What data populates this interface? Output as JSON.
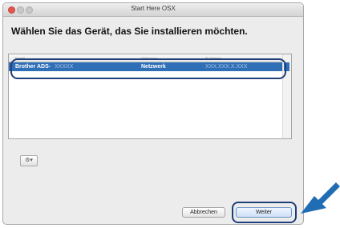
{
  "window": {
    "title": "Start Here OSX"
  },
  "heading": "Wählen Sie das Gerät, das Sie installieren möchten.",
  "list": {
    "columns": [
      "Modell",
      "Verbindung",
      "IP-Adresse"
    ],
    "rows": [
      {
        "model": "Brother ADS-",
        "model_masked": "XXXXX",
        "connection": "Netzwerk",
        "address": "XXX.XXX.X.XXX"
      }
    ]
  },
  "icons": {
    "gear": "gear-icon",
    "arrow": "pointer-arrow-icon"
  },
  "buttons": {
    "cancel": "Abbrechen",
    "next": "Weiter"
  },
  "colors": {
    "selection": "#2f6fb6",
    "callout": "#1f3f7a",
    "arrow": "#1f6db3"
  }
}
